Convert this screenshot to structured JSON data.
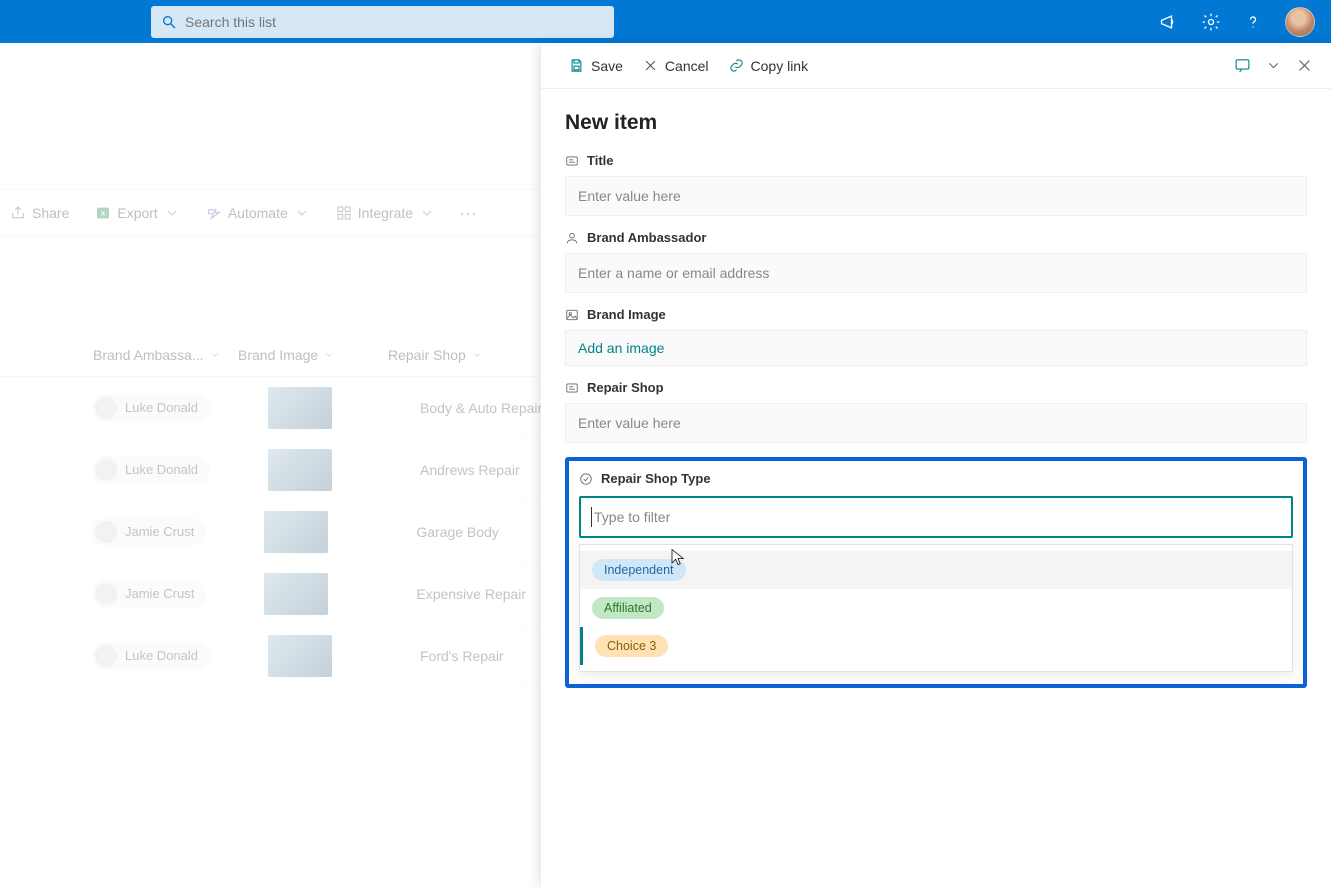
{
  "suite": {
    "search_placeholder": "Search this list"
  },
  "toolbar": {
    "share": "Share",
    "export": "Export",
    "automate": "Automate",
    "integrate": "Integrate"
  },
  "columns": {
    "ambassador": "Brand Ambassa...",
    "image": "Brand Image",
    "shop": "Repair Shop"
  },
  "rows": [
    {
      "name": "Luke Donald",
      "shop": "Body & Auto Repair"
    },
    {
      "name": "Luke Donald",
      "shop": "Andrews Repair"
    },
    {
      "name": "Jamie Crust",
      "shop": "Garage Body"
    },
    {
      "name": "Jamie Crust",
      "shop": "Expensive Repair"
    },
    {
      "name": "Luke Donald",
      "shop": "Ford's Repair"
    }
  ],
  "drawer": {
    "save": "Save",
    "cancel": "Cancel",
    "copy_link": "Copy link",
    "title": "New item",
    "fields": {
      "title": {
        "label": "Title",
        "placeholder": "Enter value here"
      },
      "ambassador": {
        "label": "Brand Ambassador",
        "placeholder": "Enter a name or email address"
      },
      "image": {
        "label": "Brand Image",
        "link": "Add an image"
      },
      "shop": {
        "label": "Repair Shop",
        "placeholder": "Enter value here"
      },
      "shop_type": {
        "label": "Repair Shop Type",
        "placeholder": "Type to filter"
      }
    },
    "options": [
      {
        "label": "Independent",
        "color": "blue"
      },
      {
        "label": "Affiliated",
        "color": "green"
      },
      {
        "label": "Choice 3",
        "color": "amber"
      }
    ]
  }
}
